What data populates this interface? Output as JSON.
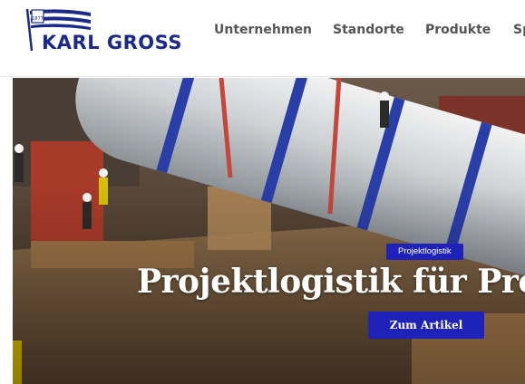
{
  "header": {
    "logo": {
      "name": "KARL GROSS",
      "badge_text": "1877"
    },
    "nav": [
      {
        "label": "Unternehmen"
      },
      {
        "label": "Standorte"
      },
      {
        "label": "Produkte"
      },
      {
        "label": "Sp"
      }
    ]
  },
  "hero": {
    "category": "Projektlogistik",
    "headline": "Projektlogistik für Proz",
    "cta_label": "Zum Artikel"
  },
  "colors": {
    "brand_blue": "#1b2a8a",
    "accent_blue": "#1e22b8",
    "nav_text": "#555555"
  }
}
